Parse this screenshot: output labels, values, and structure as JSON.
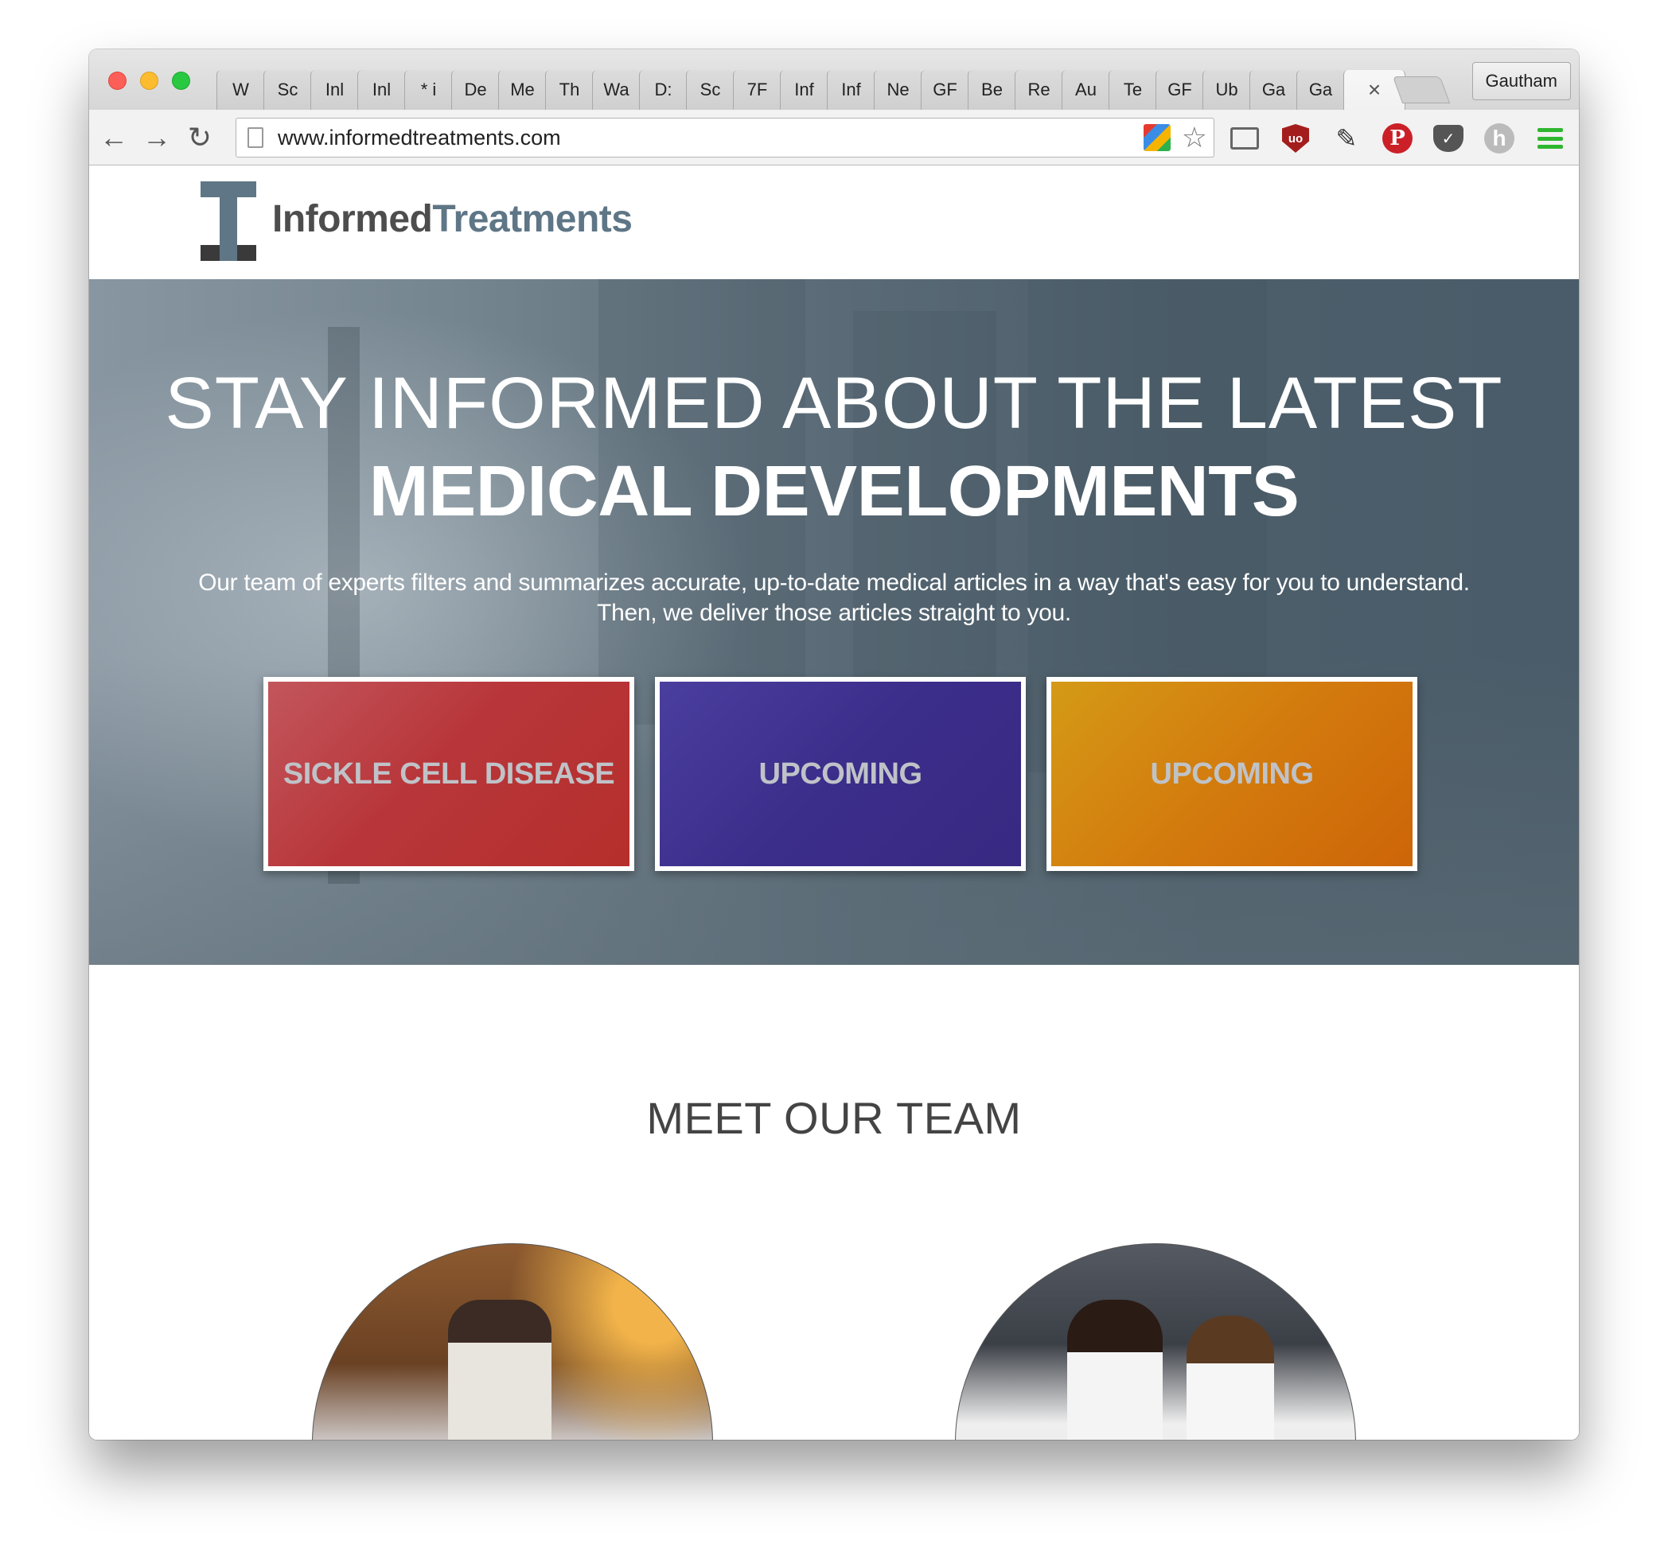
{
  "browser": {
    "tabs": [
      "W",
      "Sc",
      "Inl",
      "Inl",
      "* i",
      "De",
      "Me",
      "Th",
      "Wa",
      "D:",
      "Sc",
      "7F",
      "Inf",
      "Inf",
      "Ne",
      "GF",
      "Be",
      "Re",
      "Au",
      "Te",
      "GF",
      "Ub",
      "Ga",
      "Ga"
    ],
    "active_tab_close": "×",
    "profile_name": "Gautham",
    "url": "www.informedtreatments.com",
    "nav": {
      "back": "←",
      "forward": "→",
      "reload": "↻"
    },
    "star": "☆",
    "extensions": {
      "ublock": "uo",
      "pinterest": "P",
      "pocket": "✓",
      "hypothesis": "h",
      "dropper": "✎"
    }
  },
  "site": {
    "logo": {
      "part1": "Informed",
      "part2": "Treatments"
    },
    "hero": {
      "headline_line1": "STAY INFORMED ABOUT THE LATEST",
      "headline_line2": "MEDICAL DEVELOPMENTS",
      "subtext_line1": "Our team of experts filters and summarizes accurate, up-to-date medical articles in a way that's easy for you to understand.",
      "subtext_line2": "Then, we deliver those articles straight to you."
    },
    "cards": [
      {
        "label": "SICKLE CELL DISEASE",
        "color": "#b8363a"
      },
      {
        "label": "UPCOMING",
        "color": "#3b2d8a"
      },
      {
        "label": "UPCOMING",
        "color": "#d37b0e"
      }
    ],
    "team_title": "MEET OUR TEAM"
  },
  "colors": {
    "brand_dark": "#4d4d4d",
    "brand_accent": "#5e7686"
  }
}
